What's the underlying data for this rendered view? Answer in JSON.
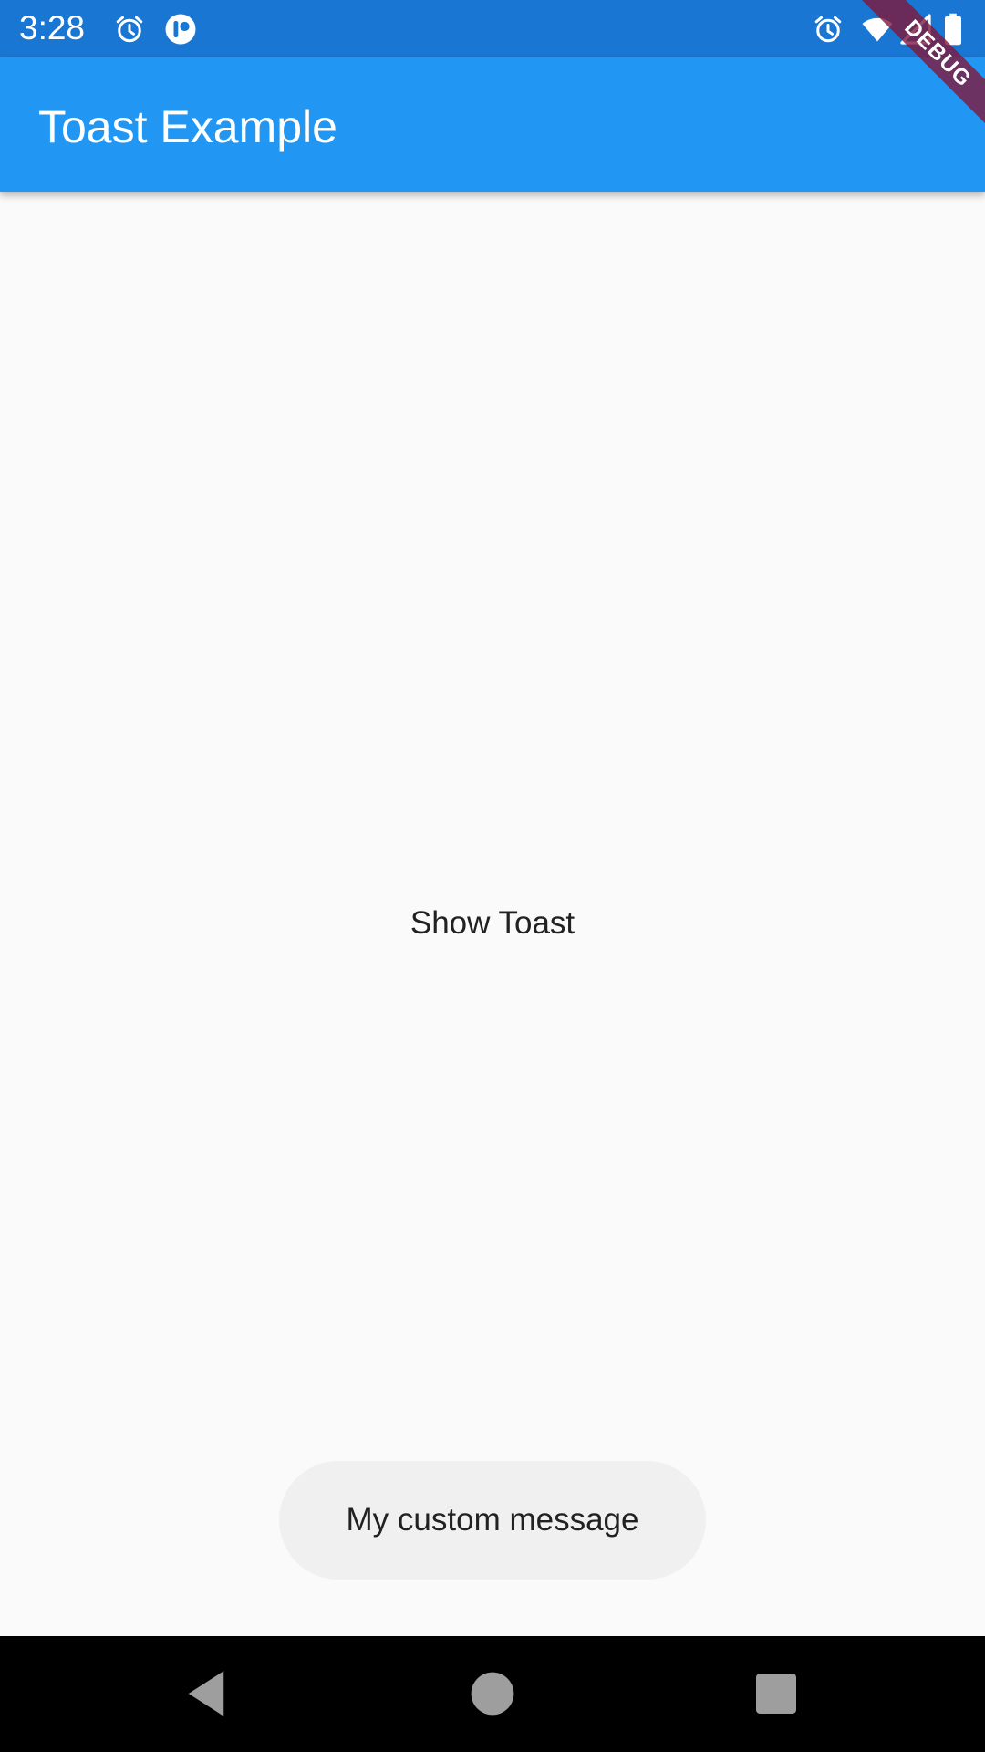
{
  "status_bar": {
    "time": "3:28",
    "left_icons": [
      "alarm-icon",
      "app-notification-icon"
    ],
    "right_icons": [
      "alarm-icon",
      "wifi-icon",
      "signal-icon",
      "battery-icon"
    ],
    "color": "#1976D2"
  },
  "app_bar": {
    "title": "Toast Example",
    "color": "#2196F3"
  },
  "debug_banner": {
    "label": "DEBUG"
  },
  "main": {
    "show_toast_label": "Show Toast"
  },
  "toast": {
    "message": "My custom message",
    "background": "#F0F0F0"
  },
  "nav_bar": {
    "buttons": [
      "back-icon",
      "home-icon",
      "recents-icon"
    ]
  }
}
